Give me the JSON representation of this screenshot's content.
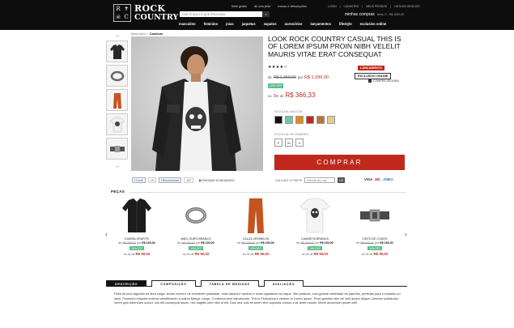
{
  "header": {
    "logo_line1": "ROCK",
    "logo_line2": "COUNTRY",
    "links": [
      "frete grátis",
      "do seu jeito",
      "trocas e devoluções"
    ],
    "top_links": [
      "LOGIN",
      "|",
      "CADASTRO",
      "|",
      "MEUS PEDIDOS",
      "|",
      "LISTA DE DESEJOS"
    ],
    "search_placeholder": "DIGITE AQUI O QUE PROCURA",
    "cart_label": "minhas compras",
    "cart_detail": "Itens: 0 - R$ 1000,00",
    "nav": [
      "masculino",
      "feminino",
      "joias",
      "jaquetas",
      "sapatos",
      "acessórios",
      "lançamentos",
      "lifestyle",
      "exclusivo online"
    ]
  },
  "breadcrumb": {
    "parent": "Masculino",
    "sep": " > ",
    "current": "Camisas"
  },
  "product": {
    "title": "LOOK ROCK COUNTRY CASUAL THIS IS OF LOREM IPSUM PROIN NIBH VELELIT MAURIS VITAE ERAT CONSEQUAT",
    "rating": "★★★★☆",
    "badge_launch": "LANÇAMENTO",
    "badge_exclusive": "EXCLUSIVO ONLINE",
    "secure": "COMPRA SEGURA",
    "price_from_prefix": "de",
    "price_old": "R$ 1.360,00",
    "price_to_prefix": "por",
    "price_new": "R$ 1.099,00",
    "discount": "10% OFF",
    "installment_prefix": "ou",
    "installment_n": "3x",
    "installment_mid": "de",
    "installment_value": "R$ 366,33",
    "color_label": "ESCOLHA UMA COR",
    "colors": [
      "#111111",
      "#6ec8a0",
      "#e08a1c",
      "#c0281c",
      "#c0703a",
      "#e8c990"
    ],
    "size_label": "ESCOLHA UM TAMANHO",
    "sizes": [
      "P",
      "M",
      "G"
    ],
    "buy_label": "COMPRAR"
  },
  "social": {
    "curtir": "Curtir",
    "curtir_count": "15",
    "recomendar": "Recomendar",
    "recomendar_count": "157",
    "share_prefix": "INDIQUE A UM AMIGO"
  },
  "freight": {
    "label": "CALCULE O FRETE",
    "placeholder": "Informe seu cep",
    "button": "OK",
    "cards": [
      "VISA",
      "MC",
      "AMEX"
    ]
  },
  "pieces": {
    "title": "PEÇAS",
    "items": [
      {
        "name": "CAMISA GRAFITE",
        "prefix": "de",
        "old": "R$ 200,00",
        "mid": "por",
        "new": "R$ 150,00",
        "disc": "10% OFF",
        "inst_prefix": "ou 3x de",
        "inst": "R$ 50,02"
      },
      {
        "name": "ANEL OURO BRANCO",
        "prefix": "de",
        "old": "R$ 200,00",
        "mid": "por",
        "new": "R$ 150,00",
        "disc": "10% OFF",
        "inst_prefix": "ou 3x de",
        "inst": "R$ 50,02"
      },
      {
        "name": "CALÇA VERMELHA",
        "prefix": "de",
        "old": "R$ 200,00",
        "mid": "por",
        "new": "R$ 150,00",
        "disc": "10% OFF",
        "inst_prefix": "ou 3x de",
        "inst": "R$ 50,02"
      },
      {
        "name": "CAMISETA BRANCA",
        "prefix": "de",
        "old": "R$ 200,00",
        "mid": "por",
        "new": "R$ 150,00",
        "disc": "10% OFF",
        "inst_prefix": "ou 3x de",
        "inst": "R$ 50,02"
      },
      {
        "name": "CINTO DE COURO",
        "prefix": "de",
        "old": "R$ 200,00",
        "mid": "por",
        "new": "R$ 150,00",
        "disc": "10% OFF",
        "inst_prefix": "ou 3x de",
        "inst": "R$ 50,02"
      }
    ]
  },
  "tabs": [
    "DESCRIÇÃO",
    "COMPOSIÇÃO",
    "TABELA DE MEDIDAS",
    "AVALIAÇÃO"
  ],
  "description": "Feita de puro algodão de fibra longa, tecido nobre e de excelente qualidade, esta camisa é durável e muito agradável ao toque. São práticas, com grande variedade de padrões, perfeitas para o trabalho ou lazer. Possuem etiqueta externa identificando a marca Mange Longe. Contenha bem estruturado. This is Photoshop's version of Lorem Ipsum. Proin gravida nibh vel velit auctor aliquet. Aenean sollicitudin, lorem quis bibendum auctor, nisi elit consequat ipsum, nec sagittis sem nibh id elit. Duis sed odio sit amet nibh vulputate cursus a sit amet mauris. Morbi accumsan ipsum velit"
}
